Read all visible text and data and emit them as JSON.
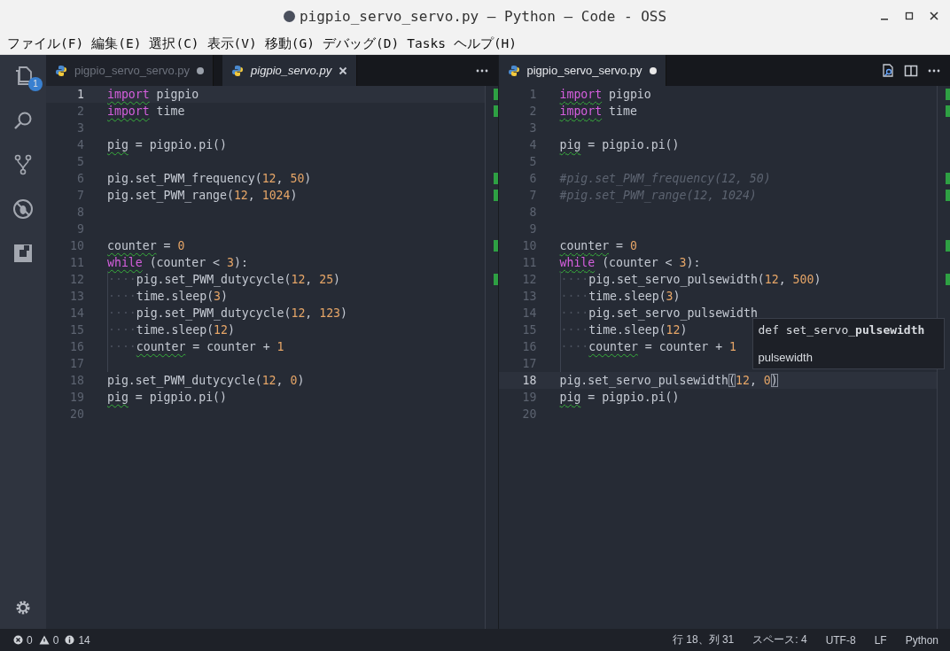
{
  "window": {
    "title": "pigpio_servo_servo.py — Python — Code - OSS",
    "dirty": true
  },
  "menu": [
    "ファイル(F)",
    "編集(E)",
    "選択(C)",
    "表示(V)",
    "移動(G)",
    "デバッグ(D)",
    "Tasks",
    "ヘルプ(H)"
  ],
  "activity_bar": {
    "items": [
      {
        "kind": "files",
        "selected": false,
        "badge": "1"
      },
      {
        "kind": "search",
        "selected": false
      },
      {
        "kind": "scm",
        "selected": false
      },
      {
        "kind": "debug",
        "selected": false
      },
      {
        "kind": "extensions",
        "selected": false
      }
    ],
    "settings": {
      "kind": "gear"
    }
  },
  "editors": [
    {
      "tabs": [
        {
          "label": "pigpio_servo_servo.py",
          "selected": false,
          "dirty": true,
          "preview": false
        },
        {
          "label": "pigpio_servo.py",
          "selected": true,
          "dirty": false,
          "preview": true
        }
      ],
      "actions": [
        {
          "kind": "more"
        }
      ],
      "lines": [
        {
          "n": "1",
          "current": true,
          "changed": true,
          "warning": true,
          "tokens": [
            {
              "text": "import",
              "kind": "keyword"
            },
            {
              "text": " pigpio",
              "kind": "plain"
            }
          ]
        },
        {
          "n": "2",
          "current": false,
          "changed": true,
          "warning": true,
          "tokens": [
            {
              "text": "import",
              "kind": "keyword"
            },
            {
              "text": " time",
              "kind": "plain"
            }
          ]
        },
        {
          "n": "3",
          "current": false,
          "changed": false,
          "warning": false
        },
        {
          "n": "4",
          "current": false,
          "changed": false,
          "warning": true,
          "tokens": [
            {
              "text": "pig",
              "kind": "plain"
            },
            {
              "text": " = pigpio.pi()",
              "kind": "plain"
            }
          ]
        },
        {
          "n": "5",
          "current": false,
          "changed": false,
          "warning": false
        },
        {
          "n": "6",
          "current": false,
          "changed": true,
          "warning": false,
          "tokens": [
            {
              "text": "pig.set_PWM_frequency(",
              "kind": "plain"
            },
            {
              "text": "12",
              "kind": "number"
            },
            {
              "text": ", ",
              "kind": "plain"
            },
            {
              "text": "50",
              "kind": "number"
            },
            {
              "text": ")",
              "kind": "plain"
            }
          ]
        },
        {
          "n": "7",
          "current": false,
          "changed": true,
          "warning": false,
          "tokens": [
            {
              "text": "pig.set_PWM_range(",
              "kind": "plain"
            },
            {
              "text": "12",
              "kind": "number"
            },
            {
              "text": ", ",
              "kind": "plain"
            },
            {
              "text": "1024",
              "kind": "number"
            },
            {
              "text": ")",
              "kind": "plain"
            }
          ]
        },
        {
          "n": "8",
          "current": false,
          "changed": false,
          "warning": false
        },
        {
          "n": "9",
          "current": false,
          "changed": false,
          "warning": false
        },
        {
          "n": "10",
          "current": false,
          "changed": true,
          "warning": true,
          "tokens": [
            {
              "text": "counter",
              "kind": "plain"
            },
            {
              "text": " = ",
              "kind": "plain"
            },
            {
              "text": "0",
              "kind": "number"
            }
          ]
        },
        {
          "n": "11",
          "current": false,
          "changed": false,
          "warning": true,
          "tokens": [
            {
              "text": "while",
              "kind": "keyword"
            },
            {
              "text": " (counter < ",
              "kind": "plain"
            },
            {
              "text": "3",
              "kind": "number"
            },
            {
              "text": "):",
              "kind": "plain"
            }
          ]
        },
        {
          "n": "12",
          "current": false,
          "changed": true,
          "warning": false,
          "tokens": [
            {
              "text": "····",
              "kind": "indent"
            },
            {
              "text": "pig.set_PWM_dutycycle(",
              "kind": "plain"
            },
            {
              "text": "12",
              "kind": "number"
            },
            {
              "text": ", ",
              "kind": "plain"
            },
            {
              "text": "25",
              "kind": "number"
            },
            {
              "text": ")",
              "kind": "plain"
            }
          ]
        },
        {
          "n": "13",
          "current": false,
          "changed": false,
          "warning": false,
          "tokens": [
            {
              "text": "····",
              "kind": "indent"
            },
            {
              "text": "time.sleep(",
              "kind": "plain"
            },
            {
              "text": "3",
              "kind": "number"
            },
            {
              "text": ")",
              "kind": "plain"
            }
          ]
        },
        {
          "n": "14",
          "current": false,
          "changed": false,
          "warning": false,
          "tokens": [
            {
              "text": "····",
              "kind": "indent"
            },
            {
              "text": "pig.set_PWM_dutycycle(",
              "kind": "plain"
            },
            {
              "text": "12",
              "kind": "number"
            },
            {
              "text": ", ",
              "kind": "plain"
            },
            {
              "text": "123",
              "kind": "number"
            },
            {
              "text": ")",
              "kind": "plain"
            }
          ]
        },
        {
          "n": "15",
          "current": false,
          "changed": false,
          "warning": false,
          "tokens": [
            {
              "text": "····",
              "kind": "indent"
            },
            {
              "text": "time.sleep(",
              "kind": "plain"
            },
            {
              "text": "12",
              "kind": "number"
            },
            {
              "text": ")",
              "kind": "plain"
            }
          ]
        },
        {
          "n": "16",
          "current": false,
          "changed": false,
          "warning": true,
          "tokens": [
            {
              "text": "····",
              "kind": "indent"
            },
            {
              "text": "counter",
              "kind": "plain"
            },
            {
              "text": " = counter + ",
              "kind": "plain"
            },
            {
              "text": "1",
              "kind": "number"
            }
          ]
        },
        {
          "n": "17",
          "current": false,
          "changed": false,
          "warning": false,
          "tokens": [
            {
              "kind": "guide"
            }
          ]
        },
        {
          "n": "18",
          "current": false,
          "changed": false,
          "warning": false,
          "tokens": [
            {
              "text": "pig.set_PWM_dutycycle(",
              "kind": "plain"
            },
            {
              "text": "12",
              "kind": "number"
            },
            {
              "text": ", ",
              "kind": "plain"
            },
            {
              "text": "0",
              "kind": "number"
            },
            {
              "text": ")",
              "kind": "plain"
            }
          ]
        },
        {
          "n": "19",
          "current": false,
          "changed": false,
          "warning": true,
          "tokens": [
            {
              "text": "pig",
              "kind": "plain"
            },
            {
              "text": " = pigpio.pi()",
              "kind": "plain"
            }
          ]
        },
        {
          "n": "20",
          "current": false,
          "changed": false,
          "warning": false
        }
      ]
    },
    {
      "tabs": [
        {
          "label": "pigpio_servo_servo.py",
          "selected": true,
          "dirty": true,
          "preview": false
        }
      ],
      "actions": [
        {
          "kind": "open-changes"
        },
        {
          "kind": "split"
        },
        {
          "kind": "more"
        }
      ],
      "lines": [
        {
          "n": "1",
          "current": false,
          "changed": true,
          "warning": true,
          "tokens": [
            {
              "text": "import",
              "kind": "keyword"
            },
            {
              "text": " pigpio",
              "kind": "plain"
            }
          ]
        },
        {
          "n": "2",
          "current": false,
          "changed": true,
          "warning": true,
          "tokens": [
            {
              "text": "import",
              "kind": "keyword"
            },
            {
              "text": " time",
              "kind": "plain"
            }
          ]
        },
        {
          "n": "3",
          "current": false,
          "changed": false,
          "warning": false
        },
        {
          "n": "4",
          "current": false,
          "changed": false,
          "warning": true,
          "tokens": [
            {
              "text": "pig",
              "kind": "plain"
            },
            {
              "text": " = pigpio.pi()",
              "kind": "plain"
            }
          ]
        },
        {
          "n": "5",
          "current": false,
          "changed": false,
          "warning": false
        },
        {
          "n": "6",
          "current": false,
          "changed": true,
          "warning": false,
          "tokens": [
            {
              "text": "#pig.set_PWM_frequency(12, 50)",
              "kind": "comment"
            }
          ]
        },
        {
          "n": "7",
          "current": false,
          "changed": true,
          "warning": false,
          "tokens": [
            {
              "text": "#pig.set_PWM_range(12, 1024)",
              "kind": "comment"
            }
          ]
        },
        {
          "n": "8",
          "current": false,
          "changed": false,
          "warning": false
        },
        {
          "n": "9",
          "current": false,
          "changed": false,
          "warning": false
        },
        {
          "n": "10",
          "current": false,
          "changed": true,
          "warning": true,
          "tokens": [
            {
              "text": "counter",
              "kind": "plain"
            },
            {
              "text": " = ",
              "kind": "plain"
            },
            {
              "text": "0",
              "kind": "number"
            }
          ]
        },
        {
          "n": "11",
          "current": false,
          "changed": false,
          "warning": true,
          "tokens": [
            {
              "text": "while",
              "kind": "keyword"
            },
            {
              "text": " (counter < ",
              "kind": "plain"
            },
            {
              "text": "3",
              "kind": "number"
            },
            {
              "text": "):",
              "kind": "plain"
            }
          ]
        },
        {
          "n": "12",
          "current": false,
          "changed": true,
          "warning": false,
          "tokens": [
            {
              "text": "····",
              "kind": "indent"
            },
            {
              "text": "pig.set_servo_pulsewidth(",
              "kind": "plain"
            },
            {
              "text": "12",
              "kind": "number"
            },
            {
              "text": ", ",
              "kind": "plain"
            },
            {
              "text": "500",
              "kind": "number"
            },
            {
              "text": ")",
              "kind": "plain"
            }
          ]
        },
        {
          "n": "13",
          "current": false,
          "changed": false,
          "warning": false,
          "tokens": [
            {
              "text": "····",
              "kind": "indent"
            },
            {
              "text": "time.sleep(",
              "kind": "plain"
            },
            {
              "text": "3",
              "kind": "number"
            },
            {
              "text": ")",
              "kind": "plain"
            }
          ]
        },
        {
          "n": "14",
          "current": false,
          "changed": false,
          "warning": false,
          "tokens": [
            {
              "text": "····",
              "kind": "indent"
            },
            {
              "text": "pig.set_servo_pulsewidth",
              "kind": "plain"
            }
          ]
        },
        {
          "n": "15",
          "current": false,
          "changed": false,
          "warning": false,
          "tokens": [
            {
              "text": "····",
              "kind": "indent"
            },
            {
              "text": "time.sleep(",
              "kind": "plain"
            },
            {
              "text": "12",
              "kind": "number"
            },
            {
              "text": ")",
              "kind": "plain"
            }
          ]
        },
        {
          "n": "16",
          "current": false,
          "changed": false,
          "warning": true,
          "tokens": [
            {
              "text": "····",
              "kind": "indent"
            },
            {
              "text": "counter",
              "kind": "plain"
            },
            {
              "text": " = counter + ",
              "kind": "plain"
            },
            {
              "text": "1",
              "kind": "number"
            }
          ]
        },
        {
          "n": "17",
          "current": false,
          "changed": false,
          "warning": false,
          "tokens": [
            {
              "kind": "guide"
            }
          ]
        },
        {
          "n": "18",
          "current": true,
          "changed": false,
          "warning": false,
          "tokens": [
            {
              "text": "pig.set_servo_pulsewidth",
              "kind": "plain"
            },
            {
              "text": "(",
              "kind": "bracket"
            },
            {
              "text": "12",
              "kind": "number"
            },
            {
              "text": ", ",
              "kind": "plain"
            },
            {
              "text": "0",
              "kind": "number"
            },
            {
              "text": ")",
              "kind": "bracket"
            }
          ]
        },
        {
          "n": "19",
          "current": false,
          "changed": false,
          "warning": true,
          "tokens": [
            {
              "text": "pig",
              "kind": "plain"
            },
            {
              "text": " = pigpio.pi()",
              "kind": "plain"
            }
          ]
        },
        {
          "n": "20",
          "current": false,
          "changed": false,
          "warning": false
        }
      ],
      "hover": {
        "signature": "def set_servo_**pulsewidth**",
        "doc": "pulsewidth"
      }
    }
  ],
  "status_bar": {
    "errors": "0",
    "warnings": "0",
    "infos": "14",
    "items": [
      "行 18、列 31",
      "スペース: 4",
      "UTF-8",
      "LF",
      "Python"
    ]
  }
}
